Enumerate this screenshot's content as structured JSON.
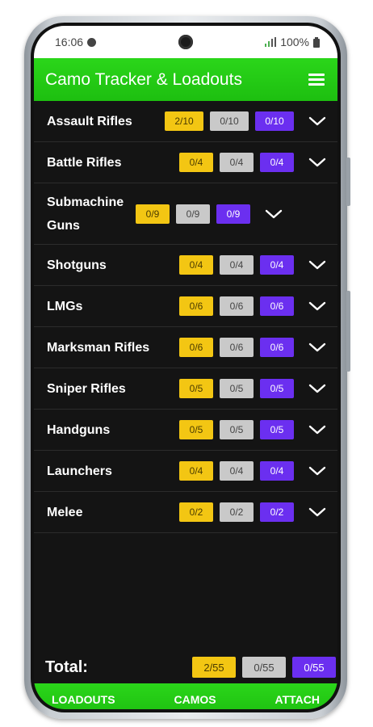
{
  "status_bar": {
    "time": "16:06",
    "battery": "100%"
  },
  "app": {
    "title": "Camo Tracker & Loadouts",
    "menu_icon": "hamburger-menu-icon"
  },
  "colors": {
    "accent": "#1dbf10",
    "gold": "#f3c613",
    "silver": "#c9c9c9",
    "purple": "#6b2ff0",
    "background": "#141414"
  },
  "categories": [
    {
      "name": "Assault Rifles",
      "gold": "2/10",
      "silver": "0/10",
      "purple": "0/10"
    },
    {
      "name": "Battle Rifles",
      "gold": "0/4",
      "silver": "0/4",
      "purple": "0/4"
    },
    {
      "name": "Submachine Guns",
      "gold": "0/9",
      "silver": "0/9",
      "purple": "0/9"
    },
    {
      "name": "Shotguns",
      "gold": "0/4",
      "silver": "0/4",
      "purple": "0/4"
    },
    {
      "name": "LMGs",
      "gold": "0/6",
      "silver": "0/6",
      "purple": "0/6"
    },
    {
      "name": "Marksman Rifles",
      "gold": "0/6",
      "silver": "0/6",
      "purple": "0/6"
    },
    {
      "name": "Sniper Rifles",
      "gold": "0/5",
      "silver": "0/5",
      "purple": "0/5"
    },
    {
      "name": "Handguns",
      "gold": "0/5",
      "silver": "0/5",
      "purple": "0/5"
    },
    {
      "name": "Launchers",
      "gold": "0/4",
      "silver": "0/4",
      "purple": "0/4"
    },
    {
      "name": "Melee",
      "gold": "0/2",
      "silver": "0/2",
      "purple": "0/2"
    }
  ],
  "total": {
    "label": "Total:",
    "gold": "2/55",
    "silver": "0/55",
    "purple": "0/55"
  },
  "bottom_nav": [
    {
      "label": "LOADOUTS"
    },
    {
      "label": "CAMOS"
    },
    {
      "label": "ATTACH"
    }
  ]
}
